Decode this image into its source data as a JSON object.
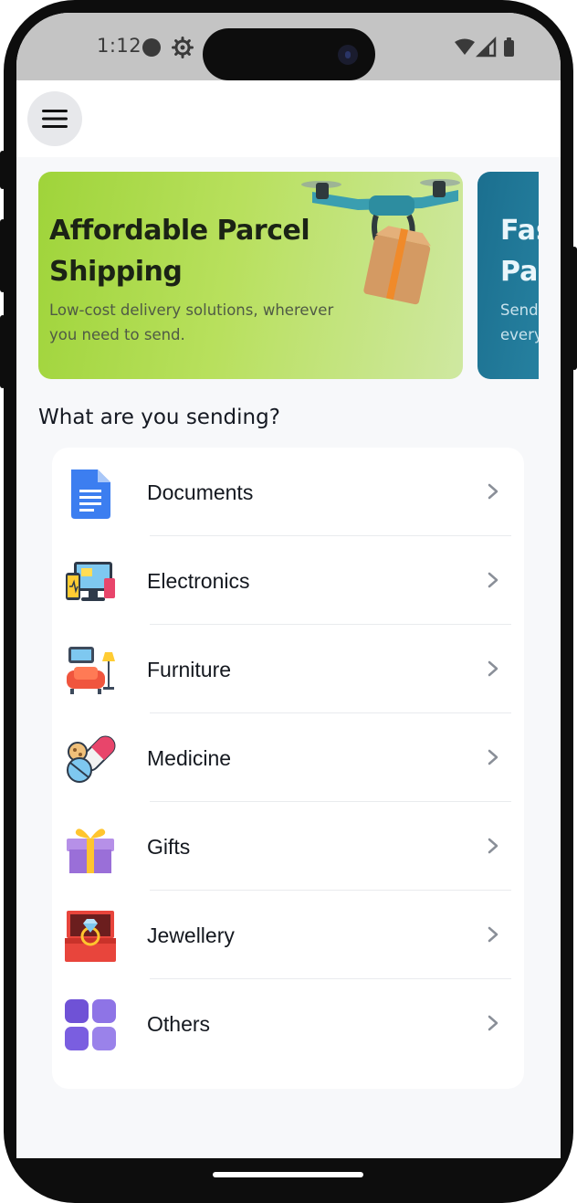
{
  "status_bar": {
    "time": "1:12",
    "icons": [
      "record-dot-icon",
      "settings-gear-icon",
      "wifi-icon",
      "signal-icon",
      "battery-icon"
    ]
  },
  "top_bar": {
    "menu_icon": "hamburger-menu-icon"
  },
  "banners": [
    {
      "title": "Affordable Parcel Shipping",
      "subtitle": "Low-cost delivery solutions, wherever you need to send.",
      "image": "drone-with-parcel",
      "color": "#a6d84a"
    },
    {
      "title": "Fas",
      "title_line2": "Par",
      "subtitle": "Send",
      "subtitle_line2": "every",
      "color": "#1f7594"
    }
  ],
  "section": {
    "title": "What are you sending?"
  },
  "categories": [
    {
      "label": "Documents",
      "icon": "document-icon"
    },
    {
      "label": "Electronics",
      "icon": "electronics-icon"
    },
    {
      "label": "Furniture",
      "icon": "furniture-icon"
    },
    {
      "label": "Medicine",
      "icon": "medicine-icon"
    },
    {
      "label": "Gifts",
      "icon": "gift-icon"
    },
    {
      "label": "Jewellery",
      "icon": "jewellery-icon"
    },
    {
      "label": "Others",
      "icon": "others-grid-icon"
    }
  ],
  "colors": {
    "accent_green": "#a6d84a",
    "accent_teal": "#1f7594",
    "background": "#f7f8fa",
    "chevron": "#8a8f98"
  }
}
